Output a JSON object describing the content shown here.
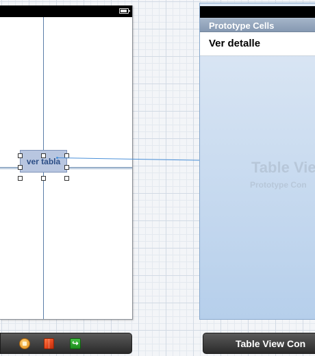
{
  "left_scene": {
    "button": {
      "label": "ver tabla"
    }
  },
  "right_scene": {
    "section_header": "Prototype Cells",
    "cell_label": "Ver detalle",
    "placeholder_title": "Table Vie",
    "placeholder_subtitle": "Prototype Con"
  },
  "left_dock": {
    "icons": [
      "first-responder-icon",
      "cube-icon",
      "exit-icon"
    ],
    "exit_glyph": "↪"
  },
  "right_dock": {
    "label": "Table View Con"
  },
  "colors": {
    "segue": "#4a90d9",
    "selection_fill": "#b8c6e0",
    "table_gradient_top": "#dfe9f5",
    "table_gradient_bottom": "#b6cfeb"
  }
}
